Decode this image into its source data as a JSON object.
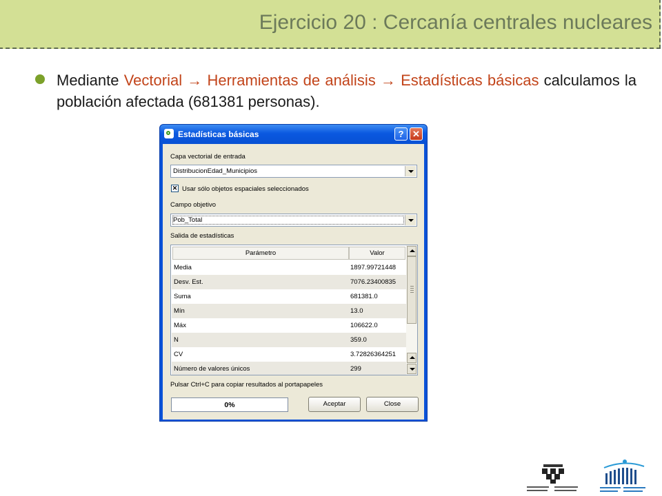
{
  "slide": {
    "title": "Ejercicio 20 : Cercanía centrales nucleares",
    "bullet": {
      "prefix": "Mediante ",
      "path": "Vectorial → Herramientas de análisis → Estadísticas básicas",
      "suffix": " calculamos la población afectada (681381 personas)."
    }
  },
  "dialog": {
    "title": "Estadísticas básicas",
    "help_label": "?",
    "close_glyph": "✕",
    "input_layer_label": "Capa vectorial de entrada",
    "input_layer_value": "DistribucionEdad_Municipios",
    "checkbox_label": "Usar sólo objetos espaciales seleccionados",
    "checkbox_checked": true,
    "target_field_label": "Campo objetivo",
    "target_field_value": "Pob_Total",
    "output_label": "Salida de estadísticas",
    "table": {
      "columns": [
        "Parámetro",
        "Valor"
      ],
      "rows": [
        {
          "param": "Media",
          "value": "1897.99721448"
        },
        {
          "param": "Desv. Est.",
          "value": "7076.23400835"
        },
        {
          "param": "Suma",
          "value": "681381.0"
        },
        {
          "param": "Mín",
          "value": "13.0"
        },
        {
          "param": "Máx",
          "value": "106622.0"
        },
        {
          "param": "N",
          "value": "359.0"
        },
        {
          "param": "CV",
          "value": "3.72826364251"
        },
        {
          "param": "Número de valores únicos",
          "value": "299"
        }
      ]
    },
    "clipboard_hint": "Pulsar Ctrl+C para copiar resultados al portapapeles",
    "progress": "0%",
    "accept_label": "Aceptar",
    "close_label": "Close"
  },
  "colors": {
    "banner": "#d3e095",
    "highlight": "#c2441a",
    "bullet": "#7ca12a",
    "titlebar": "#0a58e0"
  },
  "logos": {
    "left": "upv-ehu-logo",
    "right": "escuela-universitaria-logo"
  }
}
